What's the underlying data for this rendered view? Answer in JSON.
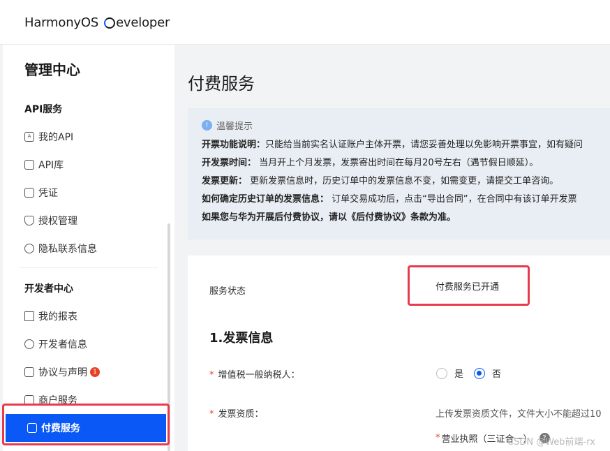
{
  "topbar": {
    "brand_part1": "HarmonyOS",
    "brand_part2": "eveloper"
  },
  "sidebar": {
    "title": "管理中心",
    "section_api": "API服务",
    "api_items": [
      {
        "label": "我的API",
        "icon": "api-icon"
      },
      {
        "label": "API库",
        "icon": "cube-icon"
      },
      {
        "label": "凭证",
        "icon": "document-icon"
      },
      {
        "label": "授权管理",
        "icon": "shield-icon"
      },
      {
        "label": "隐私联系信息",
        "icon": "user-icon"
      }
    ],
    "section_dev": "开发者中心",
    "dev_items": [
      {
        "label": "我的报表",
        "icon": "bar-chart-icon"
      },
      {
        "label": "开发者信息",
        "icon": "user-list-icon"
      },
      {
        "label": "协议与声明",
        "icon": "agreement-icon",
        "badge": "1"
      },
      {
        "label": "商户服务",
        "icon": "store-icon"
      }
    ],
    "active_item": {
      "label": "付费服务",
      "icon": "payment-icon"
    }
  },
  "main": {
    "page_title": "付费服务",
    "notice": {
      "heading": "温馨提示",
      "lines": [
        {
          "label": "开票功能说明：",
          "text": "只能给当前实名认证账户主体开票，请您妥善处理以免影响开票事宜，如有疑问"
        },
        {
          "label": "开发票时间：",
          "text": " 当月开上个月发票，发票寄出时间在每月20号左右（遇节假日顺延）。"
        },
        {
          "label": "发票更新：",
          "text": " 更新发票信息时，历史订单中的发票信息不变，如需变更，请提交工单咨询。"
        },
        {
          "label": "如何确定历史订单的发票信息：",
          "text": " 订单交易成功后，点击“导出合同”，在合同中有该订单开发票"
        },
        {
          "label": "如果您与华为开展后付费协议，请以《后付费协议》条款为准。",
          "text": ""
        }
      ]
    },
    "service_status_label": "服务状态",
    "service_status_value": "付费服务已开通",
    "section_title": "1.发票信息",
    "vat_label": "增值税一般纳税人：",
    "radio_yes": "是",
    "radio_no": "否",
    "radio_selected": "否",
    "qualification_label": "发票资质：",
    "upload_hint": "上传发票资质文件，文件大小不能超过10",
    "license_label": "营业执照（三证合一）"
  },
  "watermark": "CSDN @Web前端-rx",
  "colors": {
    "accent": "#0a59f7",
    "highlight_box": "#e83a4e",
    "badge": "#e84026"
  }
}
